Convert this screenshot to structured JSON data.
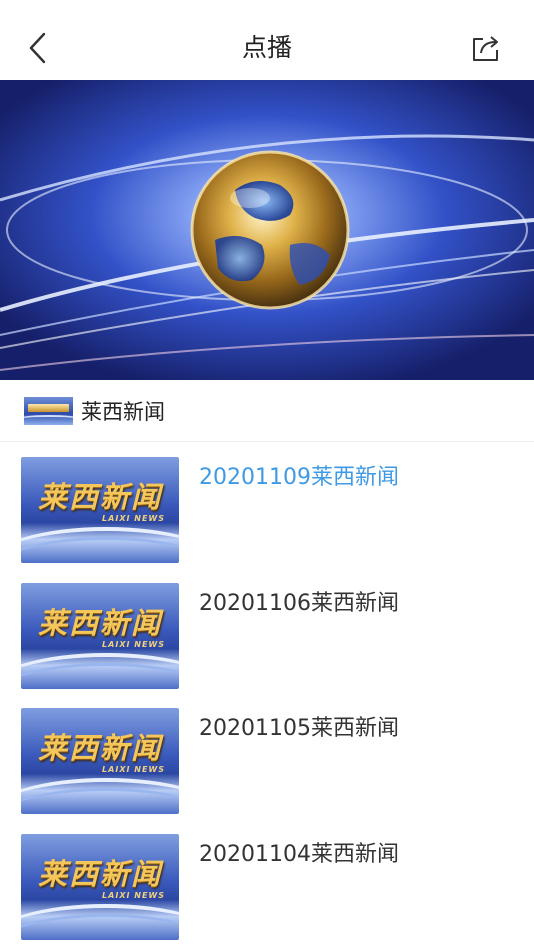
{
  "header": {
    "title": "点播"
  },
  "icons": {
    "back": "chevron-left-icon",
    "share": "share-icon"
  },
  "channel": {
    "name": "莱西新闻"
  },
  "thumbnail": {
    "logo_text": "莱西新闻",
    "logo_sub": "LAIXI NEWS"
  },
  "episodes": [
    {
      "title": "20201109莱西新闻",
      "active": true
    },
    {
      "title": "20201106莱西新闻",
      "active": false
    },
    {
      "title": "20201105莱西新闻",
      "active": false
    },
    {
      "title": "20201104莱西新闻",
      "active": false
    }
  ],
  "colors": {
    "active_title": "#3f9ae6",
    "text": "#333333"
  }
}
